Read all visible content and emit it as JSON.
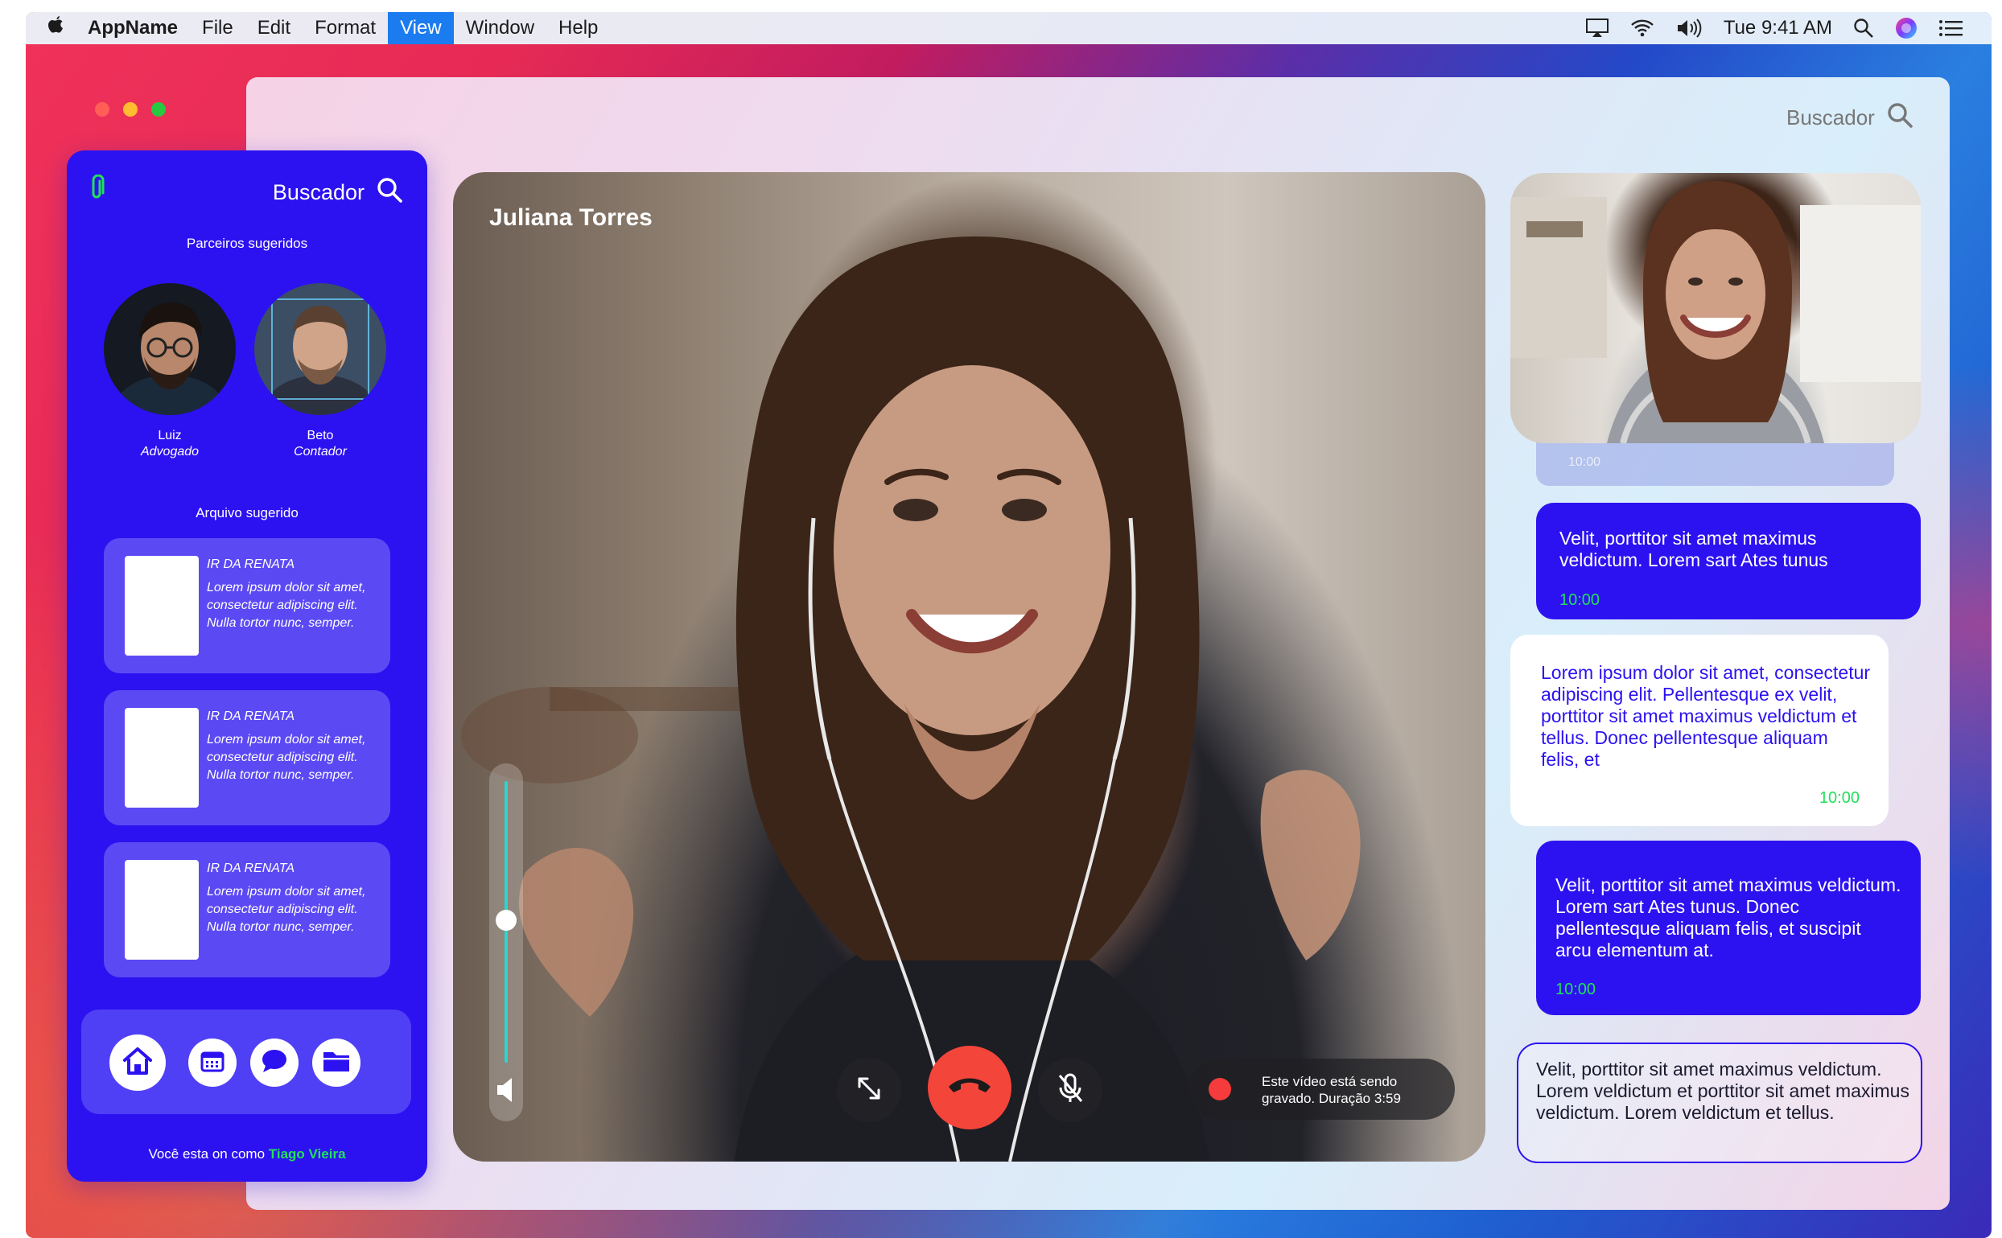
{
  "menubar": {
    "app_name": "AppName",
    "items": [
      "File",
      "Edit",
      "Format",
      "View",
      "Window",
      "Help"
    ],
    "active_item": "View",
    "clock": "Tue 9:41 AM"
  },
  "window": {
    "search_label": "Buscador"
  },
  "sidebar": {
    "search_label": "Buscador",
    "partners_heading": "Parceiros sugeridos",
    "partners": [
      {
        "name": "Luiz",
        "role": "Advogado"
      },
      {
        "name": "Beto",
        "role": "Contador"
      }
    ],
    "files_heading": "Arquivo sugerido",
    "files": [
      {
        "title": "IR DA RENATA",
        "desc": "Lorem ipsum dolor sit amet, consectetur adipiscing elit. Nulla tortor nunc, semper."
      },
      {
        "title": "IR DA RENATA",
        "desc": "Lorem ipsum dolor sit amet, consectetur adipiscing elit. Nulla tortor nunc, semper."
      },
      {
        "title": "IR DA RENATA",
        "desc": "Lorem ipsum dolor sit amet, consectetur adipiscing elit. Nulla tortor nunc, semper."
      }
    ],
    "footer_prefix": "Você esta on como",
    "footer_user": "Tiago Vieira"
  },
  "call": {
    "caller_name": "Juliana Torres",
    "volume_level": 0.62,
    "recording_text": "Este vídeo está sendo gravado. Duração 3:59"
  },
  "chat": {
    "thumb_time": "10:00",
    "messages": [
      {
        "text": "Velit, porttitor sit amet maximus veldictum. Lorem sart Ates tunus",
        "time": "10:00"
      },
      {
        "text": "Lorem ipsum dolor sit amet, consectetur adipiscing elit. Pellentesque ex velit, porttitor sit amet maximus veldictum et tellus. Donec pellentesque aliquam felis, et",
        "time": "10:00"
      },
      {
        "text": "Velit, porttitor sit amet maximus veldictum. Lorem sart Ates tunus. Donec pellentesque aliquam felis, et suscipit arcu elementum at.",
        "time": "10:00"
      },
      {
        "text": "Velit, porttitor sit amet maximus veldictum. Lorem veldictum et porttitor sit amet maximus veldictum. Lorem veldictum et tellus."
      }
    ]
  },
  "colors": {
    "accent": "#2c12f0",
    "online_green": "#22e05a",
    "hangup_red": "#f4453b"
  }
}
